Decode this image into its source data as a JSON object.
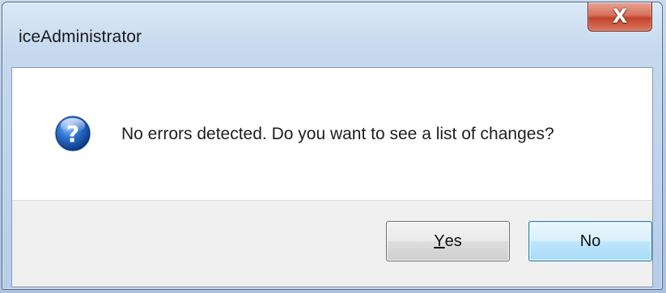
{
  "dialog": {
    "title": "iceAdministrator",
    "close_glyph": "X",
    "icon": "question-icon",
    "message": "No errors detected. Do you want to see a list of changes?"
  },
  "buttons": {
    "yes": {
      "mnemonic": "Y",
      "rest": "es"
    },
    "no": {
      "label": "No"
    }
  },
  "colors": {
    "close_button": "#c9503a",
    "question_icon": "#1f5bb5",
    "default_button_border": "#3c7fb1"
  }
}
